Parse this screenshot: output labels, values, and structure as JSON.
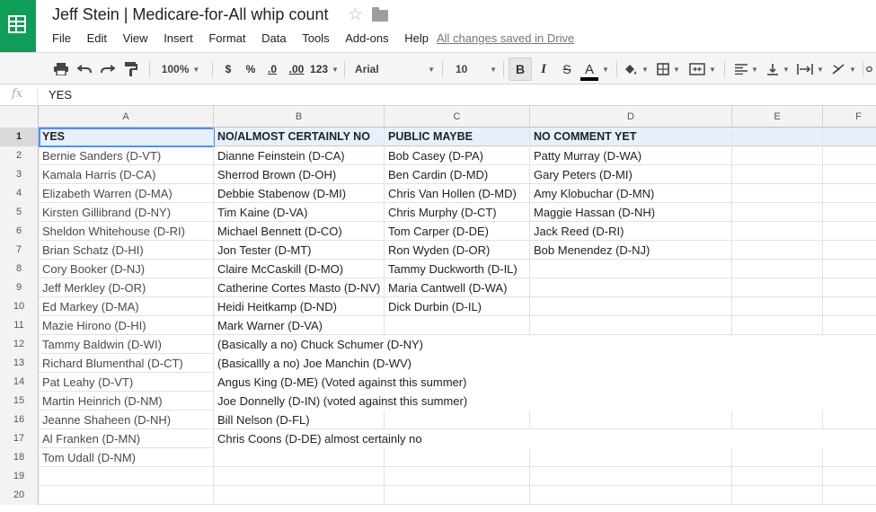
{
  "app": {
    "title": "Jeff Stein | Medicare-for-All whip count",
    "saved_status": "All changes saved in Drive"
  },
  "menu": [
    "File",
    "Edit",
    "View",
    "Insert",
    "Format",
    "Data",
    "Tools",
    "Add-ons",
    "Help"
  ],
  "toolbar": {
    "zoom": "100%",
    "currency_label": "$",
    "percent_label": "%",
    "decimal_decrease_label": ".0",
    "decimal_increase_label": ".00",
    "number_format_label": "123",
    "font": "Arial",
    "font_size": "10",
    "bold_label": "B",
    "italic_label": "I",
    "strike_label": "S",
    "text_color_label": "A"
  },
  "formula_bar": {
    "fx_label": "fx",
    "value": "YES"
  },
  "columns": [
    "A",
    "B",
    "C",
    "D",
    "E",
    "F"
  ],
  "rows": [
    {
      "num": "1",
      "cells": [
        "YES",
        "NO/ALMOST CERTAINLY NO",
        "PUBLIC MAYBE",
        "NO COMMENT YET",
        "",
        ""
      ]
    },
    {
      "num": "2",
      "cells": [
        "Bernie Sanders (D-VT)",
        "Dianne Feinstein (D-CA)",
        "Bob Casey (D-PA)",
        "Patty Murray (D-WA)",
        "",
        ""
      ]
    },
    {
      "num": "3",
      "cells": [
        "Kamala Harris (D-CA)",
        "Sherrod Brown (D-OH)",
        "Ben Cardin (D-MD)",
        "Gary Peters (D-MI)",
        "",
        ""
      ]
    },
    {
      "num": "4",
      "cells": [
        "Elizabeth Warren (D-MA)",
        "Debbie Stabenow (D-MI)",
        "Chris Van Hollen (D-MD)",
        "Amy Klobuchar (D-MN)",
        "",
        ""
      ]
    },
    {
      "num": "5",
      "cells": [
        "Kirsten Gillibrand (D-NY)",
        "Tim Kaine (D-VA)",
        "Chris Murphy (D-CT)",
        "Maggie Hassan (D-NH)",
        "",
        ""
      ]
    },
    {
      "num": "6",
      "cells": [
        "Sheldon Whitehouse (D-RI)",
        "Michael Bennett (D-CO)",
        "Tom Carper (D-DE)",
        "Jack Reed (D-RI)",
        "",
        ""
      ]
    },
    {
      "num": "7",
      "cells": [
        "Brian Schatz (D-HI)",
        "Jon Tester (D-MT)",
        "Ron Wyden (D-OR)",
        "Bob Menendez (D-NJ)",
        "",
        ""
      ]
    },
    {
      "num": "8",
      "cells": [
        "Cory Booker (D-NJ)",
        "Claire McCaskill (D-MO)",
        "Tammy Duckworth (D-IL)",
        "",
        "",
        ""
      ]
    },
    {
      "num": "9",
      "cells": [
        "Jeff Merkley (D-OR)",
        "Catherine Cortes Masto (D-NV)",
        "Maria Cantwell (D-WA)",
        "",
        "",
        ""
      ]
    },
    {
      "num": "10",
      "cells": [
        "Ed Markey (D-MA)",
        "Heidi Heitkamp (D-ND)",
        "Dick Durbin (D-IL)",
        "",
        "",
        ""
      ]
    },
    {
      "num": "11",
      "cells": [
        "Mazie Hirono (D-HI)",
        "Mark Warner (D-VA)",
        "",
        "",
        "",
        ""
      ]
    },
    {
      "num": "12",
      "cells": [
        "Tammy Baldwin (D-WI)",
        "(Basically a no) Chuck Schumer (D-NY)",
        "",
        "",
        "",
        ""
      ]
    },
    {
      "num": "13",
      "cells": [
        "Richard Blumenthal (D-CT)",
        "(Basicallly a no) Joe Manchin (D-WV)",
        "",
        "",
        "",
        ""
      ]
    },
    {
      "num": "14",
      "cells": [
        "Pat Leahy (D-VT)",
        "Angus King (D-ME) (Voted against this summer)",
        "",
        "",
        "",
        ""
      ]
    },
    {
      "num": "15",
      "cells": [
        "Martin Heinrich (D-NM)",
        "Joe Donnelly (D-IN) (voted against this summer)",
        "",
        "",
        "",
        ""
      ]
    },
    {
      "num": "16",
      "cells": [
        "Jeanne Shaheen (D-NH)",
        "Bill Nelson (D-FL)",
        "",
        "",
        "",
        ""
      ]
    },
    {
      "num": "17",
      "cells": [
        "Al Franken (D-MN)",
        "Chris Coons (D-DE) almost certainly no",
        "",
        "",
        "",
        ""
      ]
    },
    {
      "num": "18",
      "cells": [
        "Tom Udall (D-NM)",
        "",
        "",
        "",
        "",
        ""
      ]
    },
    {
      "num": "19",
      "cells": [
        "",
        "",
        "",
        "",
        "",
        ""
      ]
    },
    {
      "num": "20",
      "cells": [
        "",
        "",
        "",
        "",
        "",
        ""
      ]
    }
  ]
}
